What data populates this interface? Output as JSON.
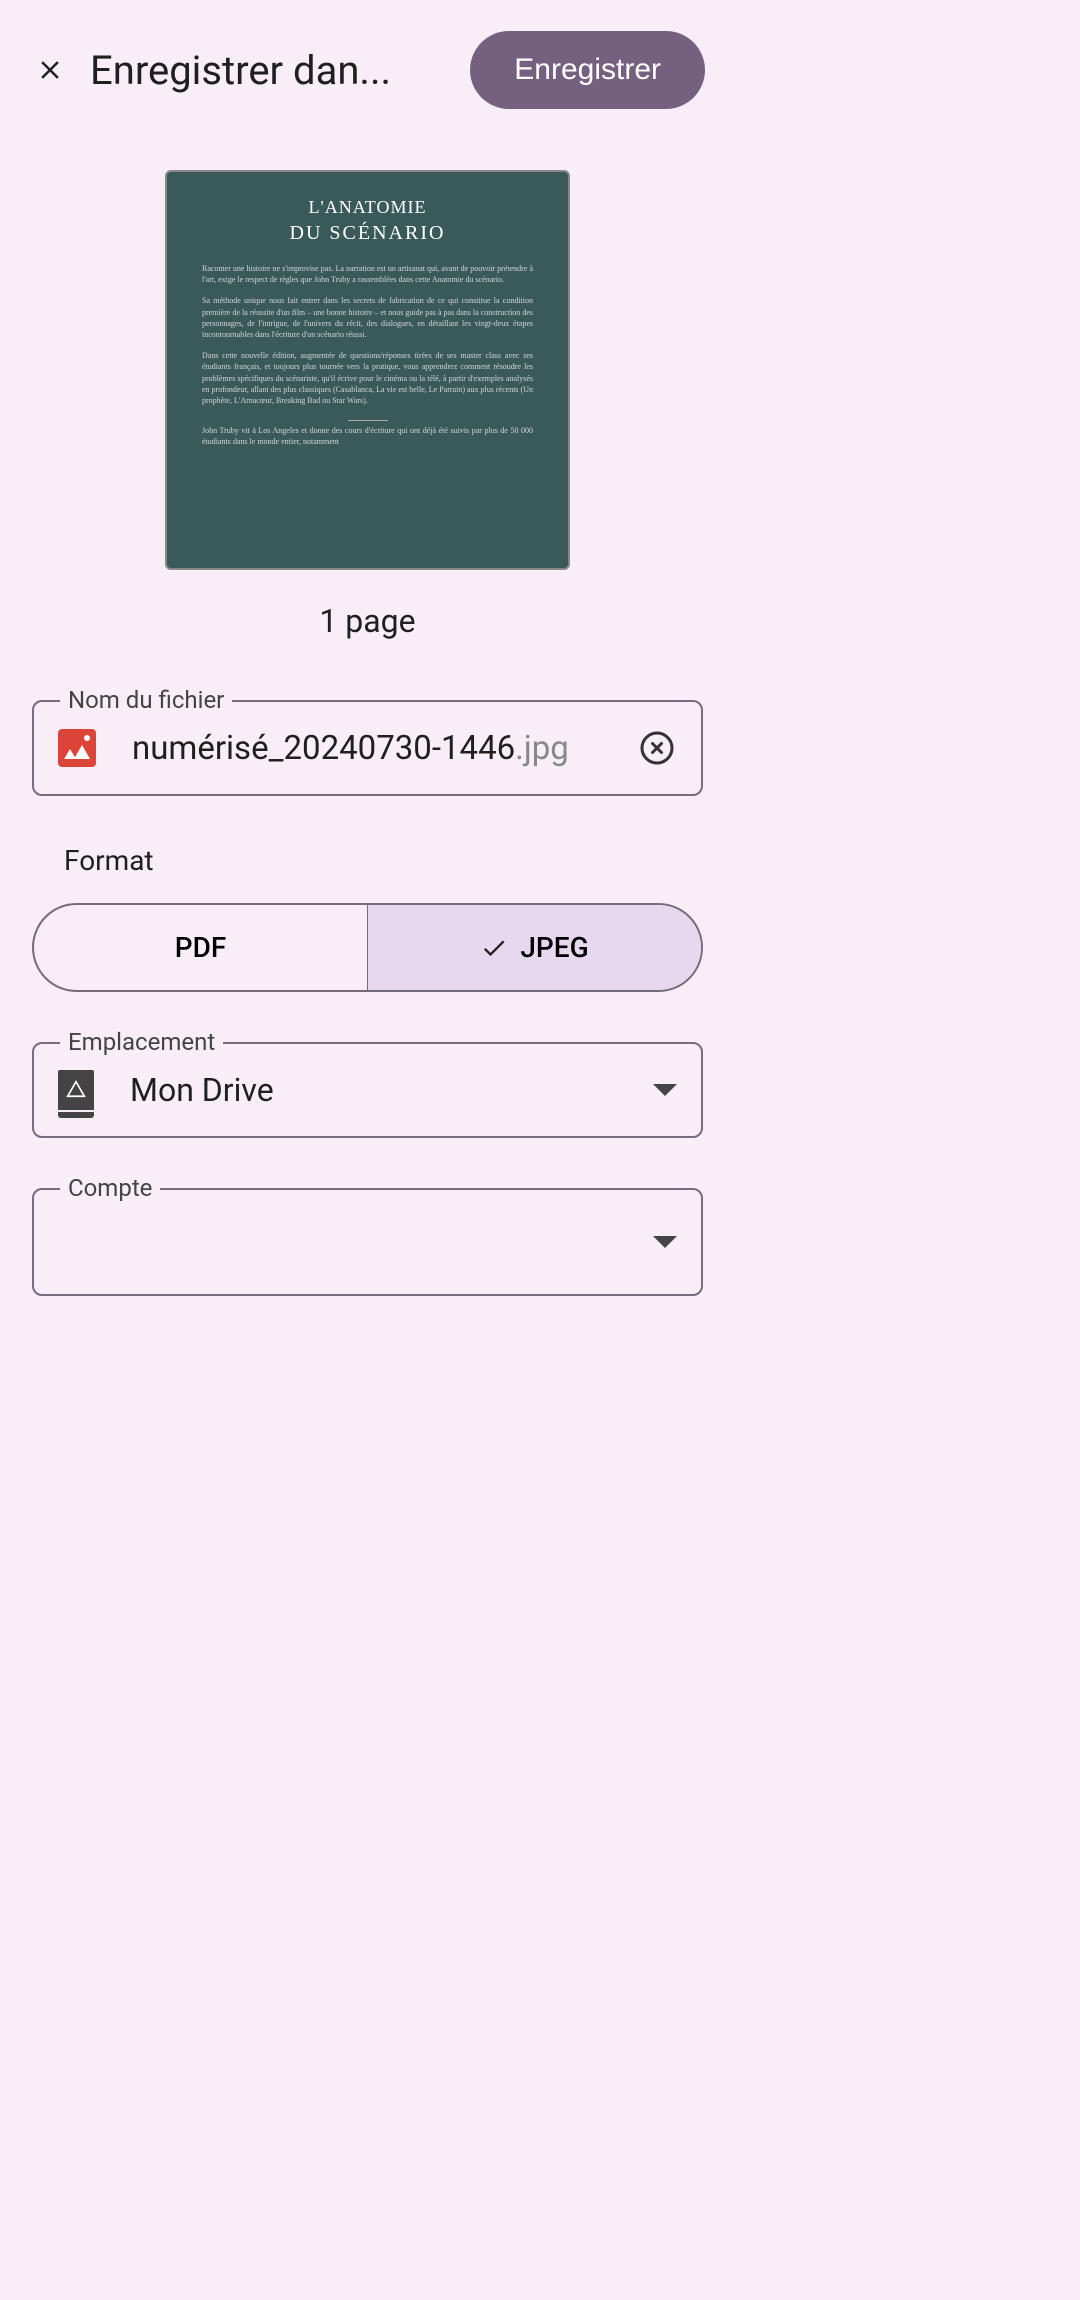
{
  "header": {
    "title": "Enregistrer dan...",
    "save_label": "Enregistrer"
  },
  "preview": {
    "title": "L'ANATOMIE",
    "subtitle": "DU SCÉNARIO",
    "para1": "Raconter une histoire ne s'improvise pas. La narration est un artisanat qui, avant de pouvoir prétendre à l'art, exige le respect de règles que John Truby a rassemblées dans cette Anatomie du scénario.",
    "para2": "Sa méthode unique nous fait entrer dans les secrets de fabrication de ce qui constitue la condition première de la réussite d'un film – une bonne histoire – et nous guide pas à pas dans la construction des personnages, de l'intrigue, de l'univers du récit, des dialogues, en détaillant les vingt-deux étapes incontournables dans l'écriture d'un scénario réussi.",
    "para3": "Dans cette nouvelle édition, augmentée de questions/réponses tirées de ses master class avec ses étudiants français, et toujours plus tournée vers la pratique, vous apprendrez comment résoudre les problèmes spécifiques du scénariste, qu'il écrive pour le cinéma ou la télé, à partir d'exemples analysés en profondeur, allant des plus classiques (Casablanca, La vie est belle, Le Parrain) aux plus récents (Un prophète, L'Arnacœur, Breaking Bad ou Star Wars).",
    "footer": "John Truby vit à Los Angeles et donne des cours d'écriture qui ont déjà été suivis par plus de 50 000 étudiants dans le monde entier, notamment",
    "page_count": "1 page"
  },
  "filename": {
    "legend": "Nom du fichier",
    "name": "numérisé_20240730-1446",
    "ext": ".jpg"
  },
  "format": {
    "label": "Format",
    "options": [
      "PDF",
      "JPEG"
    ],
    "selected": "JPEG"
  },
  "location": {
    "legend": "Emplacement",
    "value": "Mon Drive"
  },
  "account": {
    "legend": "Compte",
    "value": ""
  }
}
